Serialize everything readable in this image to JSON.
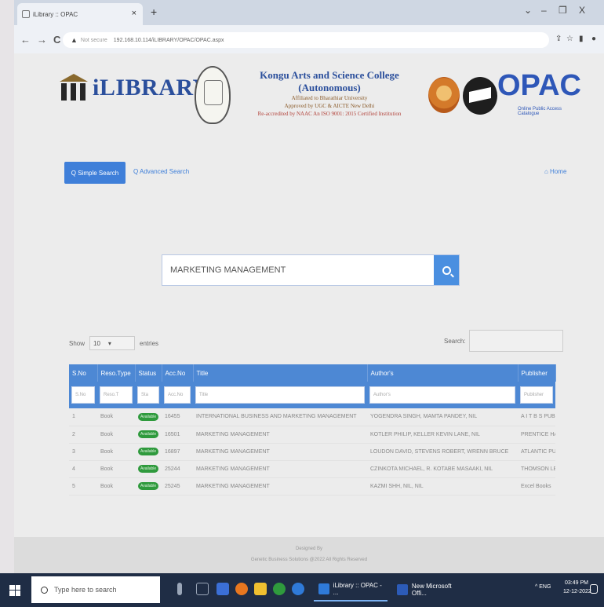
{
  "browser": {
    "tab_title": "iLibrary :: OPAC",
    "tab_close": "×",
    "new_tab": "+",
    "win_min": "⌄",
    "win_minimize": "–",
    "win_max": "❐",
    "win_close": "X",
    "nav_back": "←",
    "nav_forward": "→",
    "nav_reload": "C",
    "not_secure": "Not secure",
    "url": "192.168.10.114/iLIBRARY/OPAC/OPAC.aspx",
    "share": "⇪",
    "star": "☆",
    "ext": "▮",
    "profile": "●"
  },
  "header": {
    "brand": "iLIBRARY",
    "college_name": "Kongu Arts and Science College (Autonomous)",
    "line1": "Affiliated to Bharathiar University",
    "line2": "Approved by UGC & AICTE New Delhi",
    "line3": "Re-accredited by NAAC     An ISO 9001: 2015 Certified Institution",
    "opac": "OPAC",
    "opac_sub": "Online Public Access Catalogue"
  },
  "nav": {
    "simple_search": "Q Simple Search",
    "advanced_search": "Q Advanced Search",
    "home": "⌂ Home"
  },
  "search": {
    "value": "MARKETING MANAGEMENT"
  },
  "table_controls": {
    "show": "Show",
    "entries_value": "10",
    "entries": "entries",
    "search_label": "Search:"
  },
  "table": {
    "headers": [
      "S.No",
      "Reso.Type",
      "Status",
      "Acc.No",
      "Title",
      "Author's",
      "Publisher"
    ],
    "filters": [
      "S.No",
      "Reso.T",
      "Sta",
      "Acc.No",
      "Title",
      "Author's",
      "Publisher"
    ],
    "rows": [
      {
        "sno": "1",
        "type": "Book",
        "status": "Available",
        "acc": "16455",
        "title": "INTERNATIONAL BUSINESS AND MARKETING MANAGEMENT",
        "author": "YOGENDRA SINGH, MAMTA PANDEY, NIL",
        "publisher": "A I T B S PUB"
      },
      {
        "sno": "2",
        "type": "Book",
        "status": "Available",
        "acc": "16501",
        "title": "MARKETING MANAGEMENT",
        "author": "KOTLER PHILIP, KELLER KEVIN LANE, NIL",
        "publisher": "PRENTICE HA"
      },
      {
        "sno": "3",
        "type": "Book",
        "status": "Available",
        "acc": "16897",
        "title": "MARKETING MANAGEMENT",
        "author": "LOUDON DAVID, STEVENS ROBERT, WRENN BRUCE",
        "publisher": "ATLANTIC PUB"
      },
      {
        "sno": "4",
        "type": "Book",
        "status": "Available",
        "acc": "25244",
        "title": "MARKETING MANAGEMENT",
        "author": "CZINKOTA MICHAEL, R. KOTABE MASAAKI, NIL",
        "publisher": "THOMSON LE"
      },
      {
        "sno": "5",
        "type": "Book",
        "status": "Available",
        "acc": "25245",
        "title": "MARKETING MANAGEMENT",
        "author": "KAZMI SHH, NIL, NIL",
        "publisher": "Excel Books"
      }
    ]
  },
  "footer": {
    "line1": "Designed By",
    "line2": "Genetic Business Solutions @2022 All Rights Reserved"
  },
  "taskbar": {
    "search_placeholder": "Type here to search",
    "app1": "iLibrary :: OPAC - ...",
    "app2": "New Microsoft Offi...",
    "tray": "^  ENG",
    "time": "03:49 PM",
    "date": "12-12-2022"
  }
}
